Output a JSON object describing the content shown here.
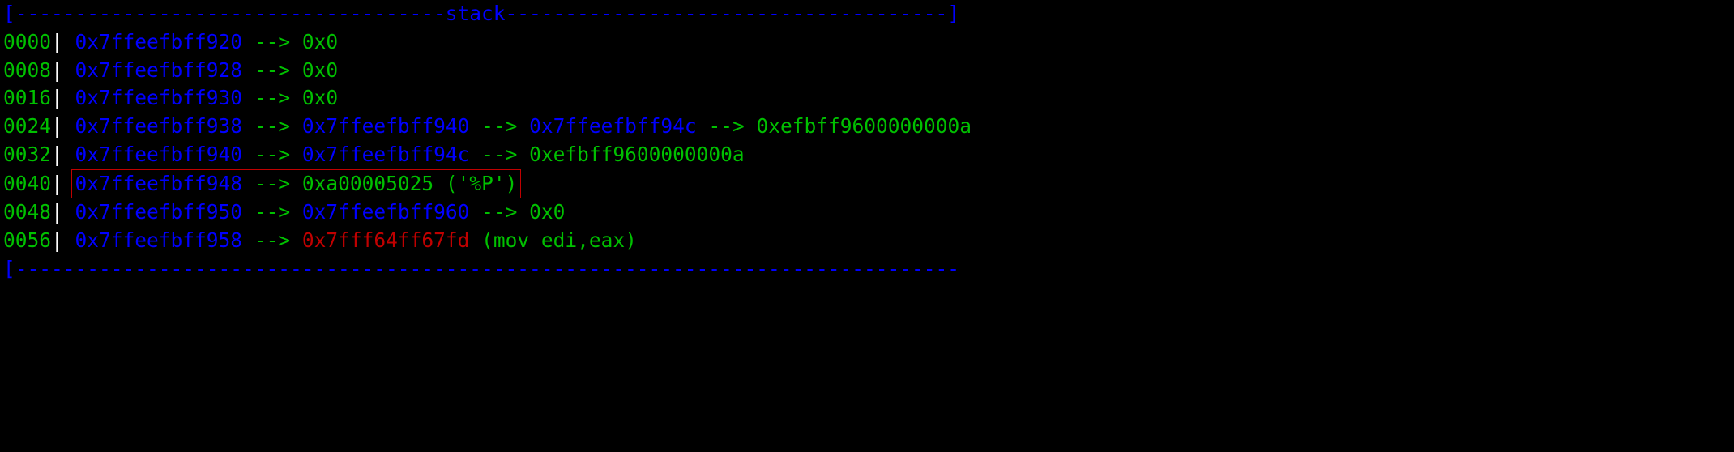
{
  "header": {
    "title": "stack",
    "dash_left": "------------------------------------",
    "dash_right": "-------------------------------------"
  },
  "footer": {
    "dash": "-------------------------------------------------------------------------------"
  },
  "rows": [
    {
      "offset": "0000",
      "addr": "0x7ffeefbff920",
      "chain": [
        {
          "kind": "value",
          "text": "0x0"
        }
      ],
      "highlight": false
    },
    {
      "offset": "0008",
      "addr": "0x7ffeefbff928",
      "chain": [
        {
          "kind": "value",
          "text": "0x0"
        }
      ],
      "highlight": false
    },
    {
      "offset": "0016",
      "addr": "0x7ffeefbff930",
      "chain": [
        {
          "kind": "value",
          "text": "0x0"
        }
      ],
      "highlight": false
    },
    {
      "offset": "0024",
      "addr": "0x7ffeefbff938",
      "chain": [
        {
          "kind": "addr",
          "text": "0x7ffeefbff940"
        },
        {
          "kind": "addr",
          "text": "0x7ffeefbff94c"
        },
        {
          "kind": "value",
          "text": "0xefbff9600000000a"
        }
      ],
      "highlight": false
    },
    {
      "offset": "0032",
      "addr": "0x7ffeefbff940",
      "chain": [
        {
          "kind": "addr",
          "text": "0x7ffeefbff94c"
        },
        {
          "kind": "value",
          "text": "0xefbff9600000000a"
        }
      ],
      "highlight": false
    },
    {
      "offset": "0040",
      "addr": "0x7ffeefbff948",
      "chain": [
        {
          "kind": "value",
          "text": "0xa00005025"
        },
        {
          "kind": "annot",
          "text": "('%P')"
        }
      ],
      "highlight": true
    },
    {
      "offset": "0048",
      "addr": "0x7ffeefbff950",
      "chain": [
        {
          "kind": "addr",
          "text": "0x7ffeefbff960"
        },
        {
          "kind": "value",
          "text": "0x0"
        }
      ],
      "highlight": false
    },
    {
      "offset": "0056",
      "addr": "0x7ffeefbff958",
      "chain": [
        {
          "kind": "code",
          "text": "0x7fff64ff67fd"
        },
        {
          "kind": "annot",
          "text": "(mov    edi,eax)"
        }
      ],
      "highlight": false
    }
  ],
  "sym": {
    "arrow": "-->",
    "pipe": "|",
    "lbrack": "[",
    "rbrack": "]"
  }
}
